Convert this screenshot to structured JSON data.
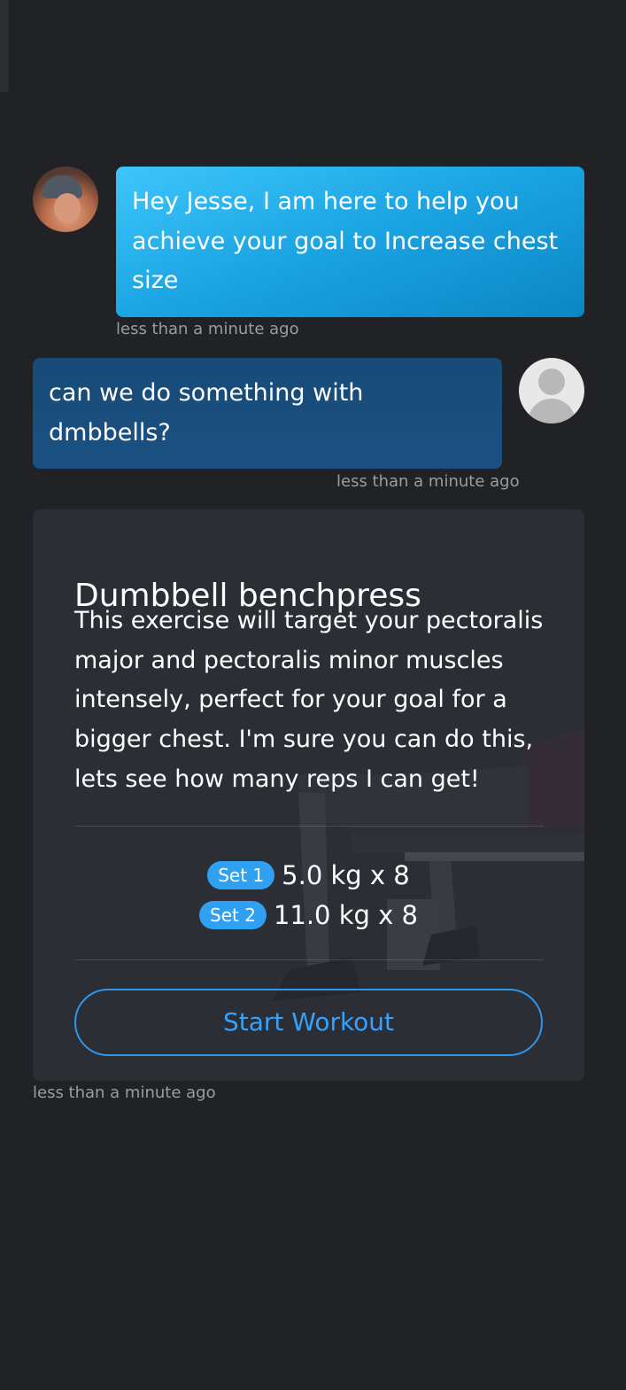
{
  "colors": {
    "background": "#202226",
    "coach_bubble": "#1aa3e2",
    "user_bubble": "#1b5182",
    "card_background": "#2c2f36",
    "accent": "#35a2ff",
    "timestamp_text": "#9a9ca1"
  },
  "chat": {
    "coach_message": {
      "avatar_icon": "coach-avatar-photo",
      "text": "Hey Jesse, I am here to help you achieve your goal to Increase chest size",
      "timestamp": "less than a minute ago"
    },
    "user_message": {
      "avatar_icon": "default-user-avatar",
      "text": "can we do something with dmbbells?",
      "timestamp": "less than a minute ago"
    },
    "exercise_card": {
      "title": "Dumbbell benchpress",
      "description": "This exercise will target your pectoralis major and pectoralis minor muscles intensely, perfect for your goal for a bigger chest. I'm sure you can do this, lets see how many reps I can get!",
      "sets": [
        {
          "label": "Set 1",
          "value": "5.0 kg x 8"
        },
        {
          "label": "Set 2",
          "value": "11.0 kg x 8"
        }
      ],
      "start_button_label": "Start Workout",
      "timestamp": "less than a minute ago"
    }
  }
}
